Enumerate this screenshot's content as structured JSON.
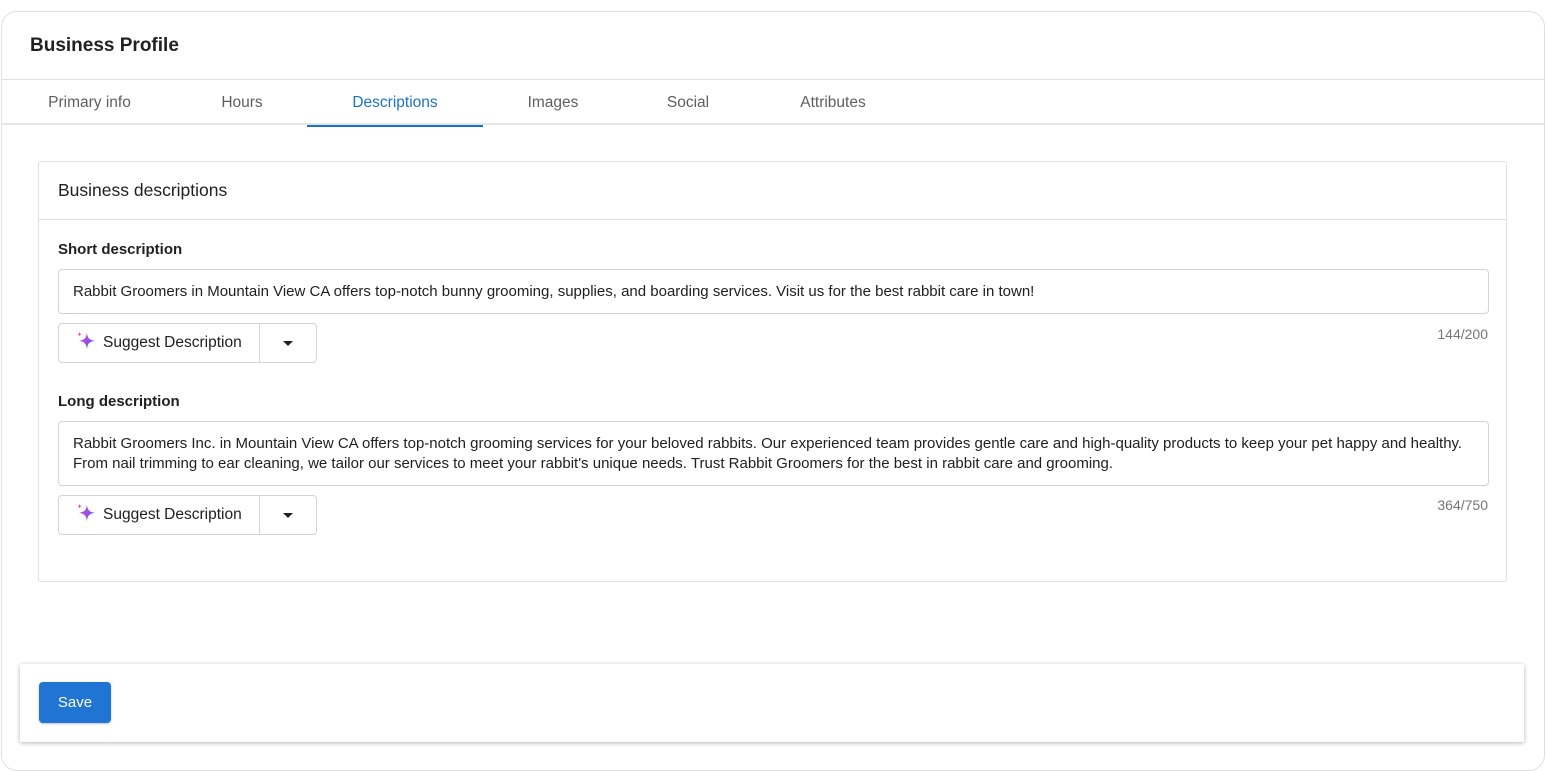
{
  "page": {
    "title": "Business Profile"
  },
  "tabs": [
    {
      "label": "Primary info",
      "active": false
    },
    {
      "label": "Hours",
      "active": false
    },
    {
      "label": "Descriptions",
      "active": true
    },
    {
      "label": "Images",
      "active": false
    },
    {
      "label": "Social",
      "active": false
    },
    {
      "label": "Attributes",
      "active": false
    }
  ],
  "card": {
    "title": "Business descriptions",
    "short": {
      "label": "Short description",
      "value": "Rabbit Groomers in Mountain View CA offers top-notch bunny grooming, supplies, and boarding services. Visit us for the best rabbit care in town!",
      "suggest_label": "Suggest Description",
      "counter": "144/200"
    },
    "long": {
      "label": "Long description",
      "value": "Rabbit Groomers Inc. in Mountain View CA offers top-notch grooming services for your beloved rabbits. Our experienced team provides gentle care and high-quality products to keep your pet happy and healthy. From nail trimming to ear cleaning, we tailor our services to meet your rabbit's unique needs. Trust Rabbit Groomers for the best in rabbit care and grooming.",
      "suggest_label": "Suggest Description",
      "counter": "364/750"
    }
  },
  "footer": {
    "save_label": "Save"
  },
  "icons": {
    "suggest": "sparkle-icon",
    "dropdown": "caret-down-icon"
  },
  "colors": {
    "accent": "#1a73c8",
    "save_button": "#1f74d4"
  }
}
